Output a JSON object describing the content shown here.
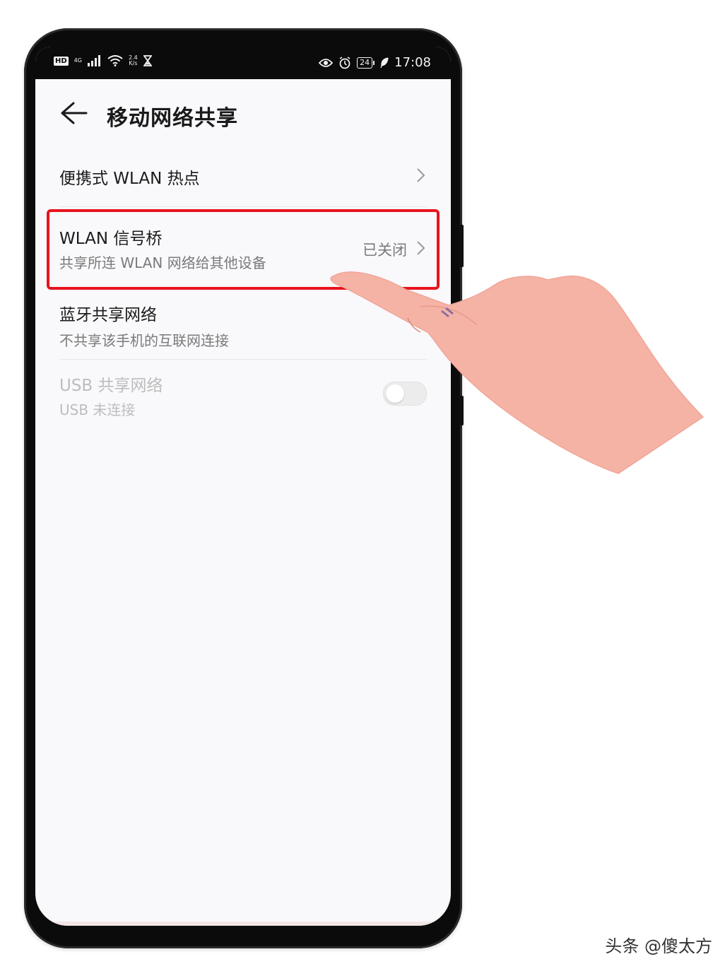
{
  "statusbar": {
    "hd_label": "HD",
    "network_label": "4G",
    "speed_value": "2.4",
    "speed_unit": "K/s",
    "battery_level": "24",
    "time": "17:08"
  },
  "header": {
    "title": "移动网络共享"
  },
  "rows": {
    "hotspot": {
      "title": "便携式 WLAN 热点"
    },
    "bridge": {
      "title": "WLAN 信号桥",
      "subtitle": "共享所连 WLAN 网络给其他设备",
      "status": "已关闭"
    },
    "bluetooth": {
      "title": "蓝牙共享网络",
      "subtitle": "不共享该手机的互联网连接"
    },
    "usb": {
      "title": "USB 共享网络",
      "subtitle": "USB 未连接",
      "toggle_on": false
    }
  },
  "colors": {
    "highlight": "#e8141d",
    "hand_fill": "#f5b3a6"
  },
  "watermark": "头条 @傻太方"
}
